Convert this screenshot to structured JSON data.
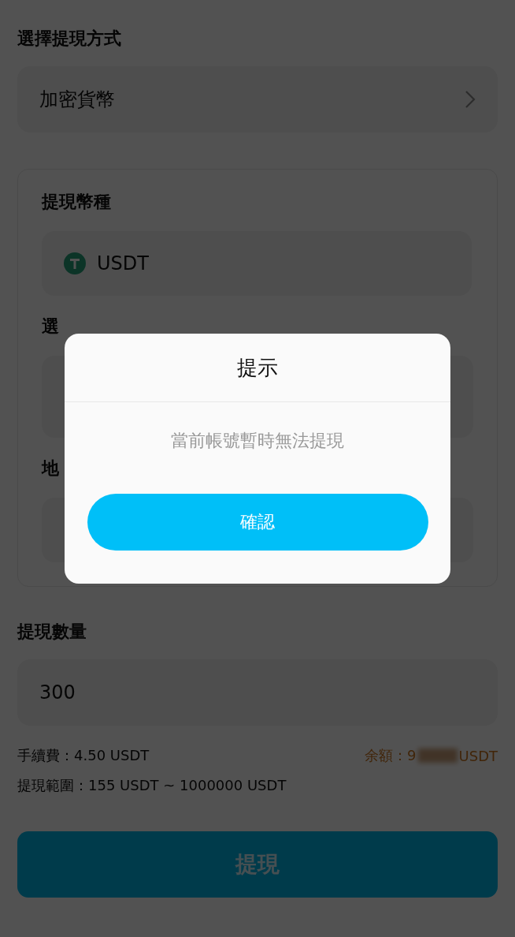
{
  "page": {
    "title": "選擇提現方式"
  },
  "method_select": {
    "value": "加密貨幣"
  },
  "currency_section": {
    "label": "提現幣種",
    "value": "USDT"
  },
  "network_section": {
    "label": "選"
  },
  "address_section": {
    "label": "地"
  },
  "amount": {
    "label": "提現數量",
    "value": "300"
  },
  "fee": "手續費：4.50 USDT",
  "range": "提現範圍：155 USDT ~ 1000000 USDT",
  "balance": {
    "label": "余額：9",
    "unit": "USDT"
  },
  "submit_button": "提現",
  "dialog": {
    "title": "提示",
    "message": "當前帳號暫時無法提現",
    "confirm_button": "確認"
  }
}
